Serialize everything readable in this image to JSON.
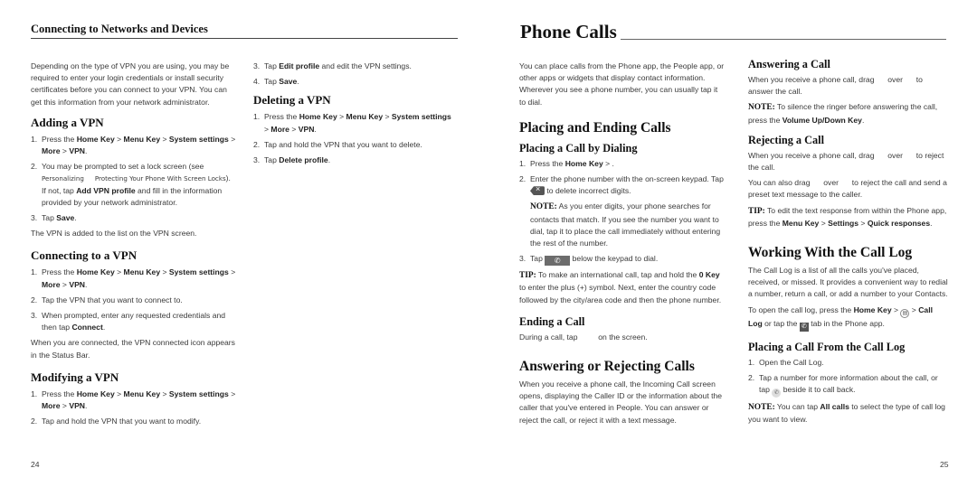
{
  "left_page": {
    "running_head": "Connecting to Networks and Devices",
    "page_number": "24",
    "intro": "Depending on the type of VPN you are using, you may be required to enter your login credentials or install security certificates before you can connect to your VPN. You can get this information from your network administrator.",
    "adding": {
      "heading": "Adding a VPN",
      "step1": {
        "num": "1.",
        "pre": "Press the ",
        "b1": "Home Key",
        "s1": " > ",
        "b2": "Menu Key",
        "s2": " > ",
        "b3": "System settings",
        "s3": " > ",
        "b4": "More",
        "s4": " > ",
        "b5": "VPN",
        "end": "."
      },
      "step2": {
        "num": "2.",
        "pre": "You may be prompted to set a lock screen (see ",
        "ref1": "Personalizing",
        "ref2": "Protecting Your Phone With Screen Locks",
        "mid": "). If not, tap ",
        "b1": "Add VPN profile",
        "end": " and fill in the information provided by your network administrator."
      },
      "step3": {
        "num": "3.",
        "pre": "Tap ",
        "b1": "Save",
        "end": "."
      },
      "after": "The VPN is added to the list on the VPN screen."
    },
    "connecting": {
      "heading": "Connecting to a VPN",
      "step1": {
        "num": "1.",
        "pre": "Press the ",
        "b1": "Home Key",
        "s1": " > ",
        "b2": "Menu Key",
        "s2": " > ",
        "b3": "System settings",
        "s3": " > ",
        "b4": "More",
        "s4": " > ",
        "b5": "VPN",
        "end": "."
      },
      "step2": {
        "num": "2.",
        "text": "Tap the VPN that you want to connect to."
      },
      "step3": {
        "num": "3.",
        "pre": "When prompted, enter any requested credentials and then tap ",
        "b1": "Connect",
        "end": "."
      },
      "after": "When you are connected, the VPN connected icon appears in the Status Bar."
    },
    "modifying": {
      "heading": "Modifying a VPN",
      "step1": {
        "num": "1.",
        "pre": "Press the ",
        "b1": "Home Key",
        "s1": " > ",
        "b2": "Menu Key",
        "s2": " > ",
        "b3": "System settings",
        "s3": " > ",
        "b4": "More",
        "s4": " > ",
        "b5": "VPN",
        "end": "."
      },
      "step2": {
        "num": "2.",
        "text": "Tap and hold the VPN that you want to modify."
      },
      "step3": {
        "num": "3.",
        "pre": "Tap ",
        "b1": "Edit profile",
        "end": " and edit the VPN settings."
      },
      "step4": {
        "num": "4.",
        "pre": "Tap ",
        "b1": "Save",
        "end": "."
      }
    },
    "deleting": {
      "heading": "Deleting a VPN",
      "step1": {
        "num": "1.",
        "pre": "Press the ",
        "b1": "Home Key",
        "s1": " > ",
        "b2": "Menu Key",
        "s2": " > ",
        "b3": "System settings",
        "s3": " > ",
        "b4": "More",
        "s4": " > ",
        "b5": "VPN",
        "end": "."
      },
      "step2": {
        "num": "2.",
        "text": "Tap and hold the VPN that you want to delete."
      },
      "step3": {
        "num": "3.",
        "pre": "Tap ",
        "b1": "Delete profile",
        "end": "."
      }
    }
  },
  "right_page": {
    "chapter_title": "Phone Calls",
    "page_number": "25",
    "intro": "You can place calls from the Phone app, the People app, or other apps or widgets that display contact information. Wherever you see a phone number, you can usually tap it to dial.",
    "placing_ending": {
      "heading": "Placing and Ending Calls",
      "dialing": {
        "heading": "Placing a Call by Dialing",
        "step1": {
          "num": "1.",
          "pre": "Press the ",
          "b1": "Home Key",
          "end": " > ."
        },
        "step2": {
          "num": "2.",
          "pre": "Enter the phone number with the on-screen keypad. Tap ",
          "end": " to delete incorrect digits."
        },
        "note": {
          "label": "NOTE:",
          "text": " As you enter digits, your phone searches for contacts that match. If you see the number you want to dial, tap it to place the call immediately without entering the rest of the number."
        },
        "step3": {
          "num": "3.",
          "pre": "Tap ",
          "end": " below the keypad to dial."
        },
        "tip": {
          "label": "TIP:",
          "pre": " To make an international call, tap and hold the ",
          "b1": "0 Key",
          "end": " to enter the plus (+) symbol. Next, enter the country code followed by the city/area code and then the phone number."
        }
      },
      "ending": {
        "heading": "Ending a Call",
        "pre": "During a call, tap ",
        "end": " on the screen."
      }
    },
    "answering_rejecting": {
      "heading": "Answering or Rejecting Calls",
      "text": "When you receive a phone call, the Incoming Call screen opens, displaying the Caller ID or the information about the caller that you've entered in People. You can answer or reject the call, or reject it with a text message."
    },
    "answering": {
      "heading": "Answering a Call",
      "pre": "When you receive a phone call, drag ",
      "mid": " over ",
      "end": " to answer the call.",
      "note": {
        "label": "NOTE:",
        "pre": " To silence the ringer before answering the call, press the ",
        "b1": "Volume Up/Down Key",
        "end": "."
      }
    },
    "rejecting": {
      "heading": "Rejecting a Call",
      "pre": "When you receive a phone call, drag ",
      "mid": " over ",
      "end": " to reject the call.",
      "p2_pre": "You can also drag ",
      "p2_mid": " over ",
      "p2_end": " to reject the call and send a preset text message to the caller.",
      "tip": {
        "label": "TIP:",
        "pre": " To edit the text response from within the Phone app, press the ",
        "b1": "Menu Key",
        "s1": " > ",
        "b2": "Settings",
        "s2": " > ",
        "b3": "Quick responses",
        "end": "."
      }
    },
    "call_log": {
      "heading": "Working With the Call Log",
      "intro": "The Call Log is a list of all the calls you've placed, received, or missed. It provides a convenient way to redial a number, return a call, or add a number to your Contacts.",
      "open": {
        "pre": "To open the call log, press the ",
        "b1": "Home Key",
        "s1": " > ",
        "s2": " > ",
        "b2": "Call Log",
        "mid": " or tap the ",
        "end": " tab in the Phone app."
      }
    },
    "from_log": {
      "heading": "Placing a Call From the Call Log",
      "step1": {
        "num": "1.",
        "text": "Open the Call Log."
      },
      "step2": {
        "num": "2.",
        "pre": "Tap a number for more information about the call, or tap ",
        "end": " beside it to call back."
      },
      "note": {
        "label": "NOTE:",
        "pre": " You can tap ",
        "b1": "All calls",
        "end": " to select the type of call log you want to view."
      }
    }
  },
  "icons": {
    "delete_key": "backspace-icon",
    "dial_button": "phone-icon",
    "apps_button": "apps-grid-icon",
    "call_log_tab": "call-log-tab-icon",
    "callback_button": "phone-callback-icon",
    "phone_glyph": "✆"
  }
}
